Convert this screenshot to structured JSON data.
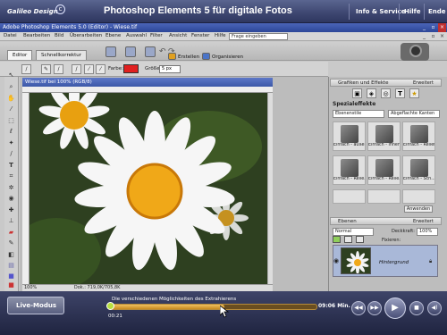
{
  "player": {
    "logo": "Galileo Design",
    "logo_mark": "c",
    "title": "Photoshop Elements 5 für digitale Fotos",
    "nav": [
      "Info & Service",
      "Hilfe",
      "Ende"
    ]
  },
  "ps": {
    "window_title": "Adobe Photoshop Elements 5.0 (Editor) - Wiese.tif",
    "menu": [
      "Datei",
      "Bearbeiten",
      "Bild",
      "Überarbeiten",
      "Ebene",
      "Auswahl",
      "Filter",
      "Ansicht",
      "Fenster",
      "Hilfe"
    ],
    "search_placeholder": "Frage eingeben",
    "tabs": {
      "editor": "Editor",
      "quick": "Schnellkorrektur"
    },
    "toolbar": {
      "create": "Erstellen",
      "organize": "Organisieren"
    },
    "options": {
      "color_label": "Farbe:",
      "size_label": "Größe:",
      "size_value": "5 px"
    },
    "document": {
      "title": "Wiese.tif bei 100% (RGB/8)",
      "status_zoom": "100%",
      "status_info": "Dok.: 719,0K/705,8K"
    },
    "palettes": {
      "effects": {
        "header": "Grafiken und Effekte",
        "expand": "Erweitert",
        "section": "Spezialeffekte",
        "select1": "Ebenenstile",
        "select2": "Abgeflachte Kanten",
        "items": [
          "Einfach - außen",
          "Einfach - innen",
          "Einfach - Relief",
          "Einfach - Relie...",
          "Einfach - Relie...",
          "Einfach - Sch..."
        ],
        "apply": "Anwenden"
      },
      "layers": {
        "header": "Ebenen",
        "expand": "Erweitert",
        "mode": "Normal",
        "opacity_label": "Deckkraft:",
        "opacity": "100%",
        "lock": "Fixieren:",
        "layer_name": "Hintergrund"
      }
    }
  },
  "controls": {
    "live_mode": "Live-Modus",
    "caption": "Die verschiedenen Möglichkeiten des Extrahierens",
    "time_current": "00:21",
    "time_total": "09:06 Min.",
    "progress": 0.56
  },
  "colors": {
    "brush": "#e02020",
    "header": "#3d4670",
    "progress": "#e0a840"
  }
}
